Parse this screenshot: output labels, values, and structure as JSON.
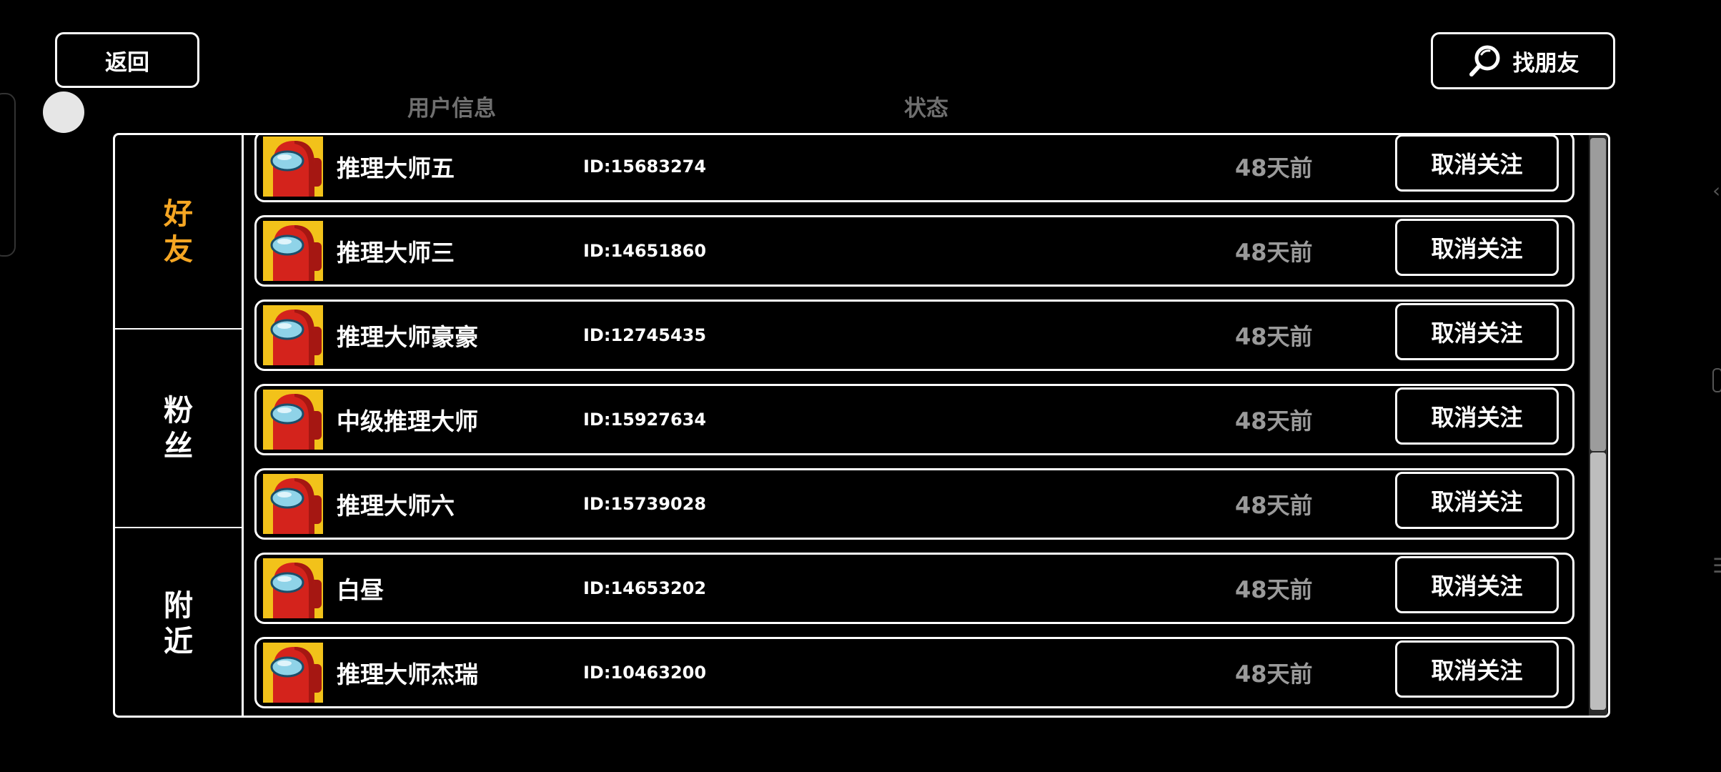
{
  "header": {
    "back_label": "返回",
    "find_friends_label": "找朋友"
  },
  "columns": {
    "user_info": "用户信息",
    "status": "状态"
  },
  "tabs": [
    {
      "label": "好友",
      "active": true,
      "color": "#f5a623"
    },
    {
      "label": "粉丝",
      "active": false
    },
    {
      "label": "附近",
      "active": false
    }
  ],
  "action_label": "取消关注",
  "rows": [
    {
      "name": "推理大师五",
      "id": "ID:15683274",
      "status": "48天前"
    },
    {
      "name": "推理大师三",
      "id": "ID:14651860",
      "status": "48天前"
    },
    {
      "name": "推理大师豪豪",
      "id": "ID:12745435",
      "status": "48天前"
    },
    {
      "name": "中级推理大师",
      "id": "ID:15927634",
      "status": "48天前"
    },
    {
      "name": "推理大师六",
      "id": "ID:15739028",
      "status": "48天前"
    },
    {
      "name": "白昼",
      "id": "ID:14653202",
      "status": "48天前"
    },
    {
      "name": "推理大师杰瑞",
      "id": "ID:10463200",
      "status": "48天前"
    }
  ],
  "colors": {
    "background": "#000000",
    "accent": "#f5a623",
    "avatar_bg": "#f2c21a",
    "crewmate_red": "#d4231c",
    "muted_text": "#9a9a9a"
  }
}
